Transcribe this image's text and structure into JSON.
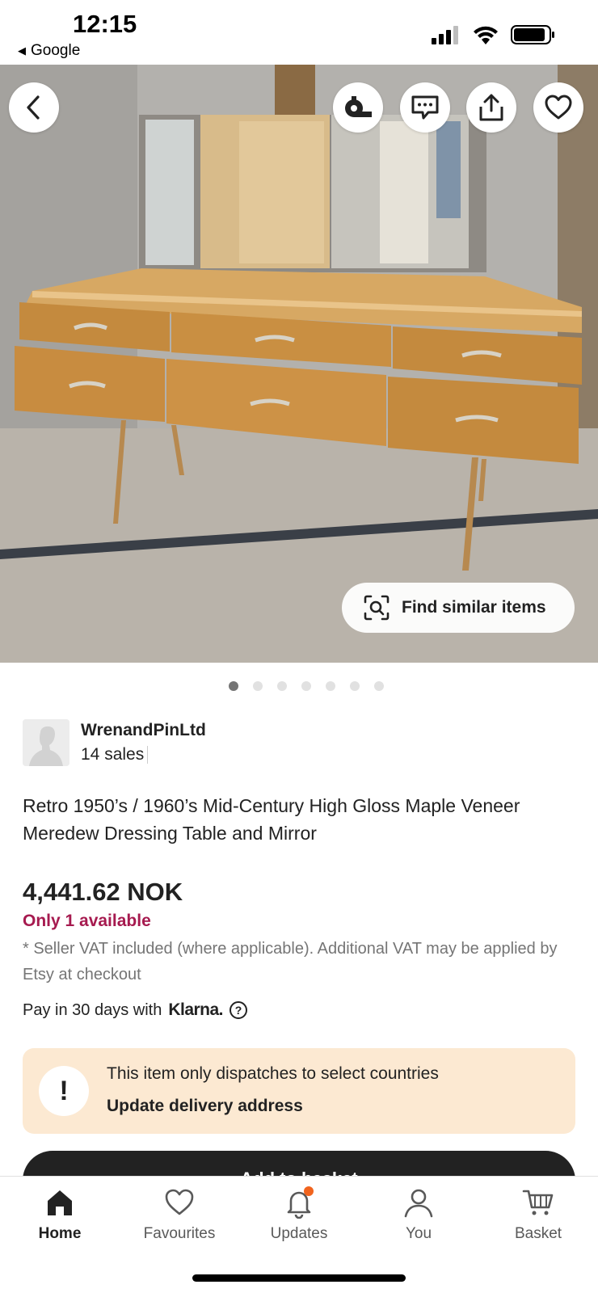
{
  "status_bar": {
    "time": "12:15",
    "back_app": "Google"
  },
  "hero": {
    "find_similar_label": "Find similar items",
    "image_count": 7,
    "active_image": 1
  },
  "seller": {
    "name": "WrenandPinLtd",
    "sales": "14 sales"
  },
  "listing": {
    "title": "Retro 1950’s / 1960’s Mid-Century High Gloss Maple Veneer Meredew Dressing Table and Mirror",
    "price": "4,441.62 NOK",
    "availability": "Only 1 available",
    "vat_note": "* Seller VAT included (where applicable). Additional VAT may be applied by Etsy at checkout",
    "klarna_text": "Pay in 30 days with",
    "klarna_brand": "Klarna.",
    "help_symbol": "?"
  },
  "notice": {
    "icon_symbol": "!",
    "message": "This item only dispatches to select countries",
    "link": "Update delivery address"
  },
  "add_to_basket_label": "Add to basket",
  "tabbar": {
    "tabs": [
      {
        "label": "Home",
        "icon": "home-icon",
        "active": true
      },
      {
        "label": "Favourites",
        "icon": "heart-icon",
        "active": false
      },
      {
        "label": "Updates",
        "icon": "bell-icon",
        "active": false
      },
      {
        "label": "You",
        "icon": "person-icon",
        "active": false
      },
      {
        "label": "Basket",
        "icon": "cart-icon",
        "active": false
      }
    ]
  },
  "colors": {
    "accent_availability": "#a61a4f",
    "notice_background": "#fce9d2",
    "notification_dot": "#f1641e",
    "button_dark": "#222222"
  }
}
